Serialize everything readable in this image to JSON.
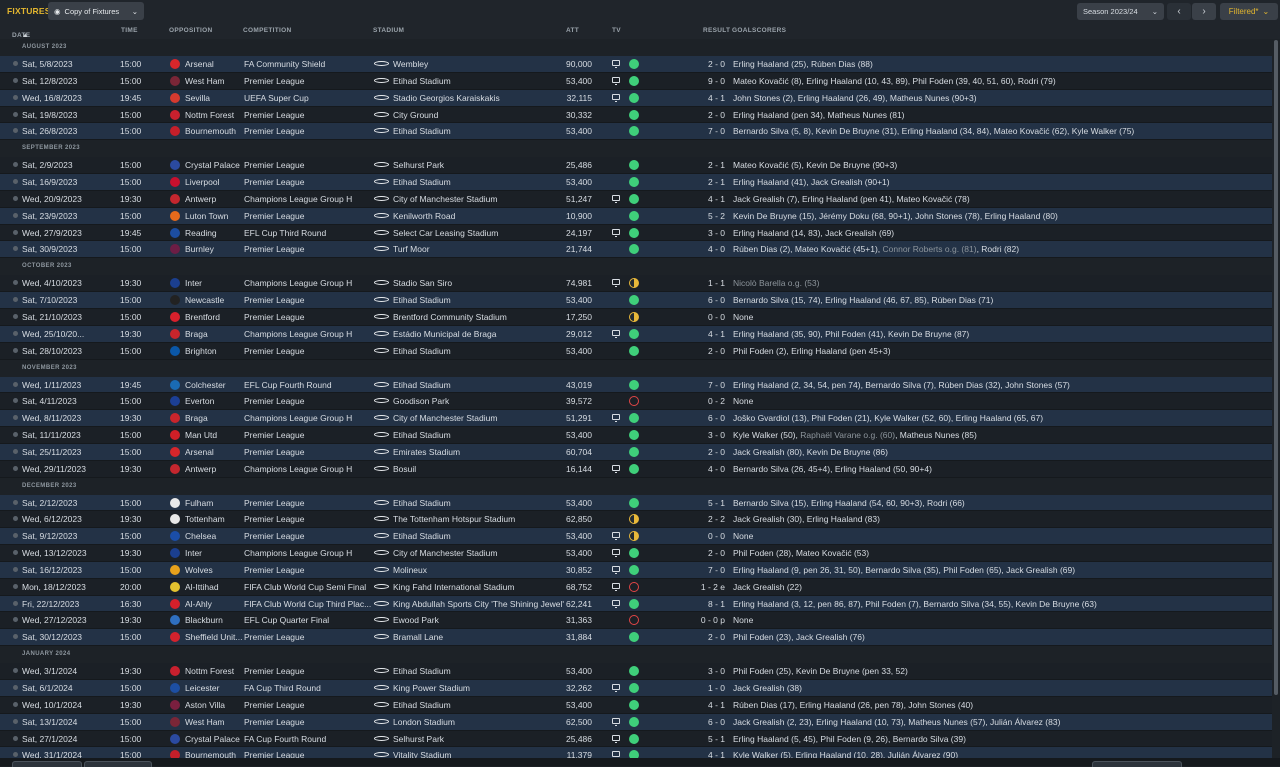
{
  "screen_title": "FIXTURES",
  "view_selector": "Copy of Fixtures",
  "season_selector": "Season 2023/24",
  "nav_prev": "‹",
  "nav_next": "›",
  "filter_label": "Filtered*",
  "columns": {
    "date": "DATE",
    "time": "TIME",
    "opposition": "OPPOSITION",
    "competition": "COMPETITION",
    "stadium": "STADIUM",
    "att": "ATT",
    "tv": "TV",
    "result": "RESULT",
    "goalscorers": "GOALSCORERS"
  },
  "colors": {
    "win": "#3fcf7a",
    "draw": "#e8b83a",
    "loss": "#e04545",
    "accent": "#e3b62f",
    "row_alt": "#233246"
  },
  "months": [
    {
      "label": "AUGUST 2023",
      "fixtures": [
        {
          "date": "Sat, 5/8/2023",
          "time": "15:00",
          "opp": "Arsenal",
          "badge": "#d7262b",
          "comp": "FA Community Shield",
          "stadium": "Wembley",
          "att": "90,000",
          "tv": true,
          "status": "W",
          "result": "2 - 0",
          "scorers": "Erling Haaland (25), Rúben Dias (88)"
        },
        {
          "date": "Sat, 12/8/2023",
          "time": "15:00",
          "opp": "West Ham",
          "badge": "#7a2637",
          "comp": "Premier League",
          "stadium": "Etihad Stadium",
          "att": "53,400",
          "tv": true,
          "status": "W",
          "result": "9 - 0",
          "scorers": "Mateo Kovačić (8), Erling Haaland (10, 43, 89), Phil Foden (39, 40, 51, 60), Rodri (79)"
        },
        {
          "date": "Wed, 16/8/2023",
          "time": "19:45",
          "opp": "Sevilla",
          "badge": "#d43a2f",
          "comp": "UEFA Super Cup",
          "stadium": "Stadio Georgios Karaiskakis",
          "att": "32,115",
          "tv": true,
          "status": "W",
          "result": "4 - 1",
          "scorers": "John Stones (2), Erling Haaland (26, 49), Matheus Nunes (90+3)"
        },
        {
          "date": "Sat, 19/8/2023",
          "time": "15:00",
          "opp": "Nottm Forest",
          "badge": "#c8202e",
          "comp": "Premier League",
          "stadium": "City Ground",
          "att": "30,332",
          "tv": false,
          "status": "W",
          "result": "2 - 0",
          "scorers": "Erling Haaland (pen 34), Matheus Nunes (81)"
        },
        {
          "date": "Sat, 26/8/2023",
          "time": "15:00",
          "opp": "Bournemouth",
          "badge": "#c51f2a",
          "comp": "Premier League",
          "stadium": "Etihad Stadium",
          "att": "53,400",
          "tv": false,
          "status": "W",
          "result": "7 - 0",
          "scorers": "Bernardo Silva (5, 8), Kevin De Bruyne (31), Erling Haaland (34, 84), Mateo Kovačić (62), Kyle Walker (75)"
        }
      ]
    },
    {
      "label": "SEPTEMBER 2023",
      "fixtures": [
        {
          "date": "Sat, 2/9/2023",
          "time": "15:00",
          "opp": "Crystal Palace",
          "badge": "#2b4aa0",
          "comp": "Premier League",
          "stadium": "Selhurst Park",
          "att": "25,486",
          "tv": false,
          "status": "W",
          "result": "2 - 1",
          "scorers": "Mateo Kovačić (5), Kevin De Bruyne (90+3)"
        },
        {
          "date": "Sat, 16/9/2023",
          "time": "15:00",
          "opp": "Liverpool",
          "badge": "#c8102e",
          "comp": "Premier League",
          "stadium": "Etihad Stadium",
          "att": "53,400",
          "tv": false,
          "status": "W",
          "result": "2 - 1",
          "scorers": "Erling Haaland (41), Jack Grealish (90+1)"
        },
        {
          "date": "Wed, 20/9/2023",
          "time": "19:30",
          "opp": "Antwerp",
          "badge": "#c4262e",
          "comp": "Champions League Group H",
          "stadium": "City of Manchester Stadium",
          "att": "51,247",
          "tv": true,
          "status": "W",
          "result": "4 - 1",
          "scorers": "Jack Grealish (7), Erling Haaland (pen 41), Mateo Kovačić (78)"
        },
        {
          "date": "Sat, 23/9/2023",
          "time": "15:00",
          "opp": "Luton Town",
          "badge": "#e56a1c",
          "comp": "Premier League",
          "stadium": "Kenilworth Road",
          "att": "10,900",
          "tv": false,
          "status": "W",
          "result": "5 - 2",
          "scorers": "Kevin De Bruyne (15), Jérémy Doku (68, 90+1), John Stones (78), Erling Haaland (80)"
        },
        {
          "date": "Wed, 27/9/2023",
          "time": "19:45",
          "opp": "Reading",
          "badge": "#1c4da1",
          "comp": "EFL Cup Third Round",
          "stadium": "Select Car Leasing Stadium",
          "att": "24,197",
          "tv": true,
          "status": "W",
          "result": "3 - 0",
          "scorers": "Erling Haaland (14, 83), Jack Grealish (69)"
        },
        {
          "date": "Sat, 30/9/2023",
          "time": "15:00",
          "opp": "Burnley",
          "badge": "#6c1d45",
          "comp": "Premier League",
          "stadium": "Turf Moor",
          "att": "21,744",
          "tv": false,
          "status": "W",
          "result": "4 - 0",
          "scorers": "Rúben Dias (2), Mateo Kovačić (45+1), ",
          "og": "Connor Roberts o.g. (81)",
          "scorers2": ", Rodri (82)"
        }
      ]
    },
    {
      "label": "OCTOBER 2023",
      "fixtures": [
        {
          "date": "Wed, 4/10/2023",
          "time": "19:30",
          "opp": "Inter",
          "badge": "#1b3f8f",
          "comp": "Champions League Group H",
          "stadium": "Stadio San Siro",
          "att": "74,981",
          "tv": true,
          "status": "D",
          "result": "1 - 1",
          "scorers": "",
          "og": "Nicolò Barella o.g. (53)"
        },
        {
          "date": "Sat, 7/10/2023",
          "time": "15:00",
          "opp": "Newcastle",
          "badge": "#222222",
          "comp": "Premier League",
          "stadium": "Etihad Stadium",
          "att": "53,400",
          "tv": false,
          "status": "W",
          "result": "6 - 0",
          "scorers": "Bernardo Silva (15, 74), Erling Haaland (46, 67, 85), Rúben Dias (71)"
        },
        {
          "date": "Sat, 21/10/2023",
          "time": "15:00",
          "opp": "Brentford",
          "badge": "#d8202c",
          "comp": "Premier League",
          "stadium": "Brentford Community Stadium",
          "att": "17,250",
          "tv": false,
          "status": "D",
          "result": "0 - 0",
          "scorers": "None"
        },
        {
          "date": "Wed, 25/10/20...",
          "time": "19:30",
          "opp": "Braga",
          "badge": "#c9252c",
          "comp": "Champions League Group H",
          "stadium": "Estádio Municipal de Braga",
          "att": "29,012",
          "tv": true,
          "status": "W",
          "result": "4 - 1",
          "scorers": "Erling Haaland (35, 90), Phil Foden (41), Kevin De Bruyne (87)"
        },
        {
          "date": "Sat, 28/10/2023",
          "time": "15:00",
          "opp": "Brighton",
          "badge": "#0a57a8",
          "comp": "Premier League",
          "stadium": "Etihad Stadium",
          "att": "53,400",
          "tv": false,
          "status": "W",
          "result": "2 - 0",
          "scorers": "Phil Foden (2), Erling Haaland (pen 45+3)"
        }
      ]
    },
    {
      "label": "NOVEMBER 2023",
      "fixtures": [
        {
          "date": "Wed, 1/11/2023",
          "time": "19:45",
          "opp": "Colchester",
          "badge": "#1a6bb3",
          "comp": "EFL Cup Fourth Round",
          "stadium": "Etihad Stadium",
          "att": "43,019",
          "tv": false,
          "status": "W",
          "result": "7 - 0",
          "scorers": "Erling Haaland (2, 34, 54, pen 74), Bernardo Silva (7), Rúben Dias (32), John Stones (57)"
        },
        {
          "date": "Sat, 4/11/2023",
          "time": "15:00",
          "opp": "Everton",
          "badge": "#1c3f95",
          "comp": "Premier League",
          "stadium": "Goodison Park",
          "att": "39,572",
          "tv": false,
          "status": "L",
          "result": "0 - 2",
          "scorers": "None"
        },
        {
          "date": "Wed, 8/11/2023",
          "time": "19:30",
          "opp": "Braga",
          "badge": "#c9252c",
          "comp": "Champions League Group H",
          "stadium": "City of Manchester Stadium",
          "att": "51,291",
          "tv": true,
          "status": "W",
          "result": "6 - 0",
          "scorers": "Joško Gvardiol (13), Phil Foden (21), Kyle Walker (52, 60), Erling Haaland (65, 67)"
        },
        {
          "date": "Sat, 11/11/2023",
          "time": "15:00",
          "opp": "Man Utd",
          "badge": "#d01f27",
          "comp": "Premier League",
          "stadium": "Etihad Stadium",
          "att": "53,400",
          "tv": false,
          "status": "W",
          "result": "3 - 0",
          "scorers": "Kyle Walker (50), ",
          "og": "Raphaël Varane o.g. (60)",
          "scorers2": ", Matheus Nunes (85)"
        },
        {
          "date": "Sat, 25/11/2023",
          "time": "15:00",
          "opp": "Arsenal",
          "badge": "#d7262b",
          "comp": "Premier League",
          "stadium": "Emirates Stadium",
          "att": "60,704",
          "tv": false,
          "status": "W",
          "result": "2 - 0",
          "scorers": "Jack Grealish (80), Kevin De Bruyne (86)"
        },
        {
          "date": "Wed, 29/11/2023",
          "time": "19:30",
          "opp": "Antwerp",
          "badge": "#c4262e",
          "comp": "Champions League Group H",
          "stadium": "Bosuil",
          "att": "16,144",
          "tv": true,
          "status": "W",
          "result": "4 - 0",
          "scorers": "Bernardo Silva (26, 45+4), Erling Haaland (50, 90+4)"
        }
      ]
    },
    {
      "label": "DECEMBER 2023",
      "fixtures": [
        {
          "date": "Sat, 2/12/2023",
          "time": "15:00",
          "opp": "Fulham",
          "badge": "#e8e8e8",
          "comp": "Premier League",
          "stadium": "Etihad Stadium",
          "att": "53,400",
          "tv": false,
          "status": "W",
          "result": "5 - 1",
          "scorers": "Bernardo Silva (15), Erling Haaland (54, 60, 90+3), Rodri (66)"
        },
        {
          "date": "Wed, 6/12/2023",
          "time": "19:30",
          "opp": "Tottenham",
          "badge": "#e8e8e8",
          "comp": "Premier League",
          "stadium": "The Tottenham Hotspur Stadium",
          "att": "62,850",
          "tv": false,
          "status": "D",
          "result": "2 - 2",
          "scorers": "Jack Grealish (30), Erling Haaland (83)"
        },
        {
          "date": "Sat, 9/12/2023",
          "time": "15:00",
          "opp": "Chelsea",
          "badge": "#1b4ea8",
          "comp": "Premier League",
          "stadium": "Etihad Stadium",
          "att": "53,400",
          "tv": true,
          "status": "D",
          "result": "0 - 0",
          "scorers": "None"
        },
        {
          "date": "Wed, 13/12/2023",
          "time": "19:30",
          "opp": "Inter",
          "badge": "#1b3f8f",
          "comp": "Champions League Group H",
          "stadium": "City of Manchester Stadium",
          "att": "53,400",
          "tv": true,
          "status": "W",
          "result": "2 - 0",
          "scorers": "Phil Foden (28), Mateo Kovačić (53)"
        },
        {
          "date": "Sat, 16/12/2023",
          "time": "15:00",
          "opp": "Wolves",
          "badge": "#e8a21c",
          "comp": "Premier League",
          "stadium": "Molineux",
          "att": "30,852",
          "tv": true,
          "status": "W",
          "result": "7 - 0",
          "scorers": "Erling Haaland (9, pen 26, 31, 50), Bernardo Silva (35), Phil Foden (65), Jack Grealish (69)"
        },
        {
          "date": "Mon, 18/12/2023",
          "time": "20:00",
          "opp": "Al-Ittihad",
          "badge": "#e3c22f",
          "comp": "FIFA Club World Cup Semi Final",
          "stadium": "King Fahd International Stadium",
          "att": "68,752",
          "tv": true,
          "status": "L",
          "result": "1 - 2 e",
          "scorers": "Jack Grealish (22)"
        },
        {
          "date": "Fri, 22/12/2023",
          "time": "16:30",
          "opp": "Al-Ahly",
          "badge": "#d4202b",
          "comp": "FIFA Club World Cup Third Plac...",
          "stadium": "King Abdullah Sports City 'The Shining Jewel'",
          "att": "62,241",
          "tv": true,
          "status": "W",
          "result": "8 - 1",
          "scorers": "Erling Haaland (3, 12, pen 86, 87), Phil Foden (7), Bernardo Silva (34, 55), Kevin De Bruyne (63)"
        },
        {
          "date": "Wed, 27/12/2023",
          "time": "19:30",
          "opp": "Blackburn",
          "badge": "#2f6fc0",
          "comp": "EFL Cup Quarter Final",
          "stadium": "Ewood Park",
          "att": "31,363",
          "tv": false,
          "status": "L",
          "result": "0 - 0 p",
          "scorers": "None"
        },
        {
          "date": "Sat, 30/12/2023",
          "time": "15:00",
          "opp": "Sheffield Unit...",
          "badge": "#d3222d",
          "comp": "Premier League",
          "stadium": "Bramall Lane",
          "att": "31,884",
          "tv": false,
          "status": "W",
          "result": "2 - 0",
          "scorers": "Phil Foden (23), Jack Grealish (76)"
        }
      ]
    },
    {
      "label": "JANUARY 2024",
      "fixtures": [
        {
          "date": "Wed, 3/1/2024",
          "time": "19:30",
          "opp": "Nottm Forest",
          "badge": "#c8202e",
          "comp": "Premier League",
          "stadium": "Etihad Stadium",
          "att": "53,400",
          "tv": false,
          "status": "W",
          "result": "3 - 0",
          "scorers": "Phil Foden (25), Kevin De Bruyne (pen 33, 52)"
        },
        {
          "date": "Sat, 6/1/2024",
          "time": "15:00",
          "opp": "Leicester",
          "badge": "#1d4fa3",
          "comp": "FA Cup Third Round",
          "stadium": "King Power Stadium",
          "att": "32,262",
          "tv": true,
          "status": "W",
          "result": "1 - 0",
          "scorers": "Jack Grealish (38)"
        },
        {
          "date": "Wed, 10/1/2024",
          "time": "19:30",
          "opp": "Aston Villa",
          "badge": "#7b1f3f",
          "comp": "Premier League",
          "stadium": "Etihad Stadium",
          "att": "53,400",
          "tv": false,
          "status": "W",
          "result": "4 - 1",
          "scorers": "Rúben Dias (17), Erling Haaland (26, pen 78), John Stones (40)"
        },
        {
          "date": "Sat, 13/1/2024",
          "time": "15:00",
          "opp": "West Ham",
          "badge": "#7a2637",
          "comp": "Premier League",
          "stadium": "London Stadium",
          "att": "62,500",
          "tv": true,
          "status": "W",
          "result": "6 - 0",
          "scorers": "Jack Grealish (2, 23), Erling Haaland (10, 73), Matheus Nunes (57), Julián Álvarez (83)"
        },
        {
          "date": "Sat, 27/1/2024",
          "time": "15:00",
          "opp": "Crystal Palace",
          "badge": "#2b4aa0",
          "comp": "FA Cup Fourth Round",
          "stadium": "Selhurst Park",
          "att": "25,486",
          "tv": true,
          "status": "W",
          "result": "5 - 1",
          "scorers": "Erling Haaland (5, 45), Phil Foden (9, 26), Bernardo Silva (39)"
        },
        {
          "date": "Wed, 31/1/2024",
          "time": "15:00",
          "opp": "Bournemouth",
          "badge": "#c51f2a",
          "comp": "Premier League",
          "stadium": "Vitality Stadium",
          "att": "11,379",
          "tv": true,
          "status": "W",
          "result": "4 - 1",
          "scorers": "Kyle Walker (5), Erling Haaland (10, 28), Julián Álvarez (90)"
        }
      ]
    }
  ]
}
